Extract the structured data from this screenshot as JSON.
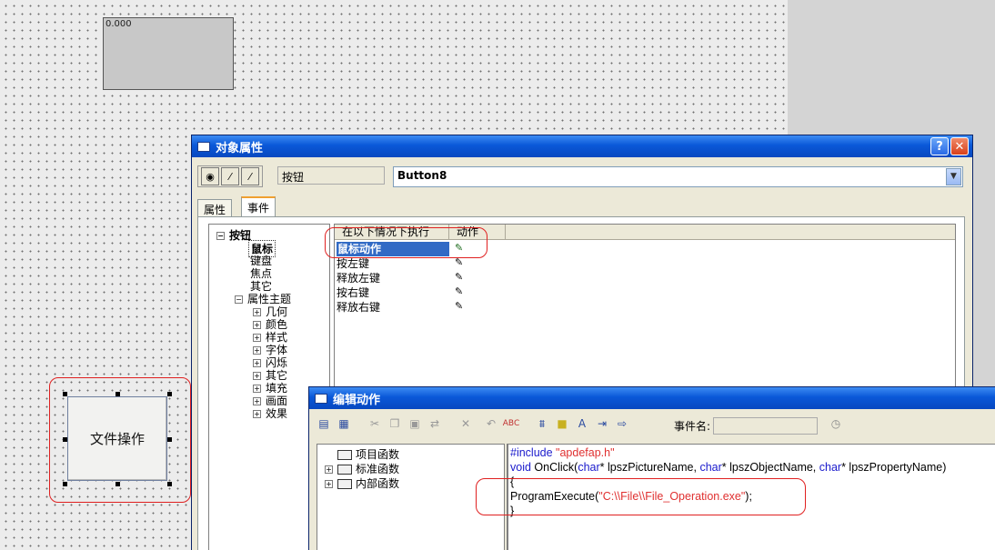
{
  "canvas": {
    "io_field_value": "0.000",
    "button_label": "文件操作"
  },
  "props_window": {
    "title": "对象属性",
    "help_label": "?",
    "close_label": "✕",
    "object_type": "按钮",
    "object_name": "Button8",
    "tabs": [
      "属性",
      "事件"
    ],
    "tree": {
      "root": "按钮",
      "items": [
        "鼠标",
        "键盘",
        "焦点",
        "其它",
        "属性主题"
      ],
      "sub_items": [
        "几何",
        "颜色",
        "样式",
        "字体",
        "闪烁",
        "其它",
        "填充",
        "画面",
        "效果"
      ]
    },
    "event_table": {
      "headers": [
        "在以下情况下执行",
        "动作"
      ],
      "rows": [
        "鼠标动作",
        "按左键",
        "释放左键",
        "按右键",
        "释放右键"
      ]
    }
  },
  "edit_window": {
    "title": "编辑动作",
    "event_name_label": "事件名:",
    "event_name_value": "",
    "func_tree": [
      "项目函数",
      "标准函数",
      "内部函数"
    ],
    "code": {
      "line1_pre": "#include ",
      "line1_str": "\"apdefap.h\"",
      "line2_kw": "void",
      "line2_mid1": " OnClick(",
      "line2_kw2": "char",
      "line2_mid2": "* lpszPictureName, ",
      "line2_kw3": "char",
      "line2_mid3": "* lpszObjectName, ",
      "line2_kw4": "char",
      "line2_mid4": "* lpszPropertyName)",
      "line3": "{",
      "line4_pre": "ProgramExecute(",
      "line4_str": "\"C:\\\\File\\\\File_Operation.exe\"",
      "line4_post": ");",
      "line5": "}"
    }
  },
  "colors": {
    "title_blue": "#0a58d8",
    "highlight_red": "#e02020",
    "keyword_blue": "#1a1acc",
    "string_red": "#e03030"
  }
}
